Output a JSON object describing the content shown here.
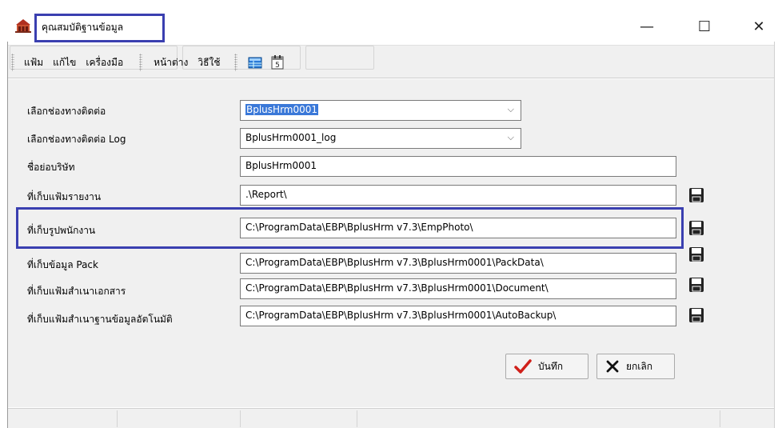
{
  "window": {
    "title": "คุณสมบัติฐานข้อมูล",
    "minimize": "—",
    "maximize": "☐",
    "close": "✕"
  },
  "menu": {
    "items": [
      "แฟ้ม",
      "แก้ไข",
      "เครื่องมือ"
    ],
    "items2": [
      "หน้าต่าง",
      "วิธีใช้"
    ]
  },
  "form": {
    "rows": [
      {
        "label": "เลือกช่องทางติดต่อ",
        "value": "BplusHrm0001",
        "type": "combo",
        "selected": true
      },
      {
        "label": "เลือกช่องทางติดต่อ Log",
        "value": "BplusHrm0001_log",
        "type": "combo"
      },
      {
        "label": "ชื่อย่อบริษัท",
        "value": "BplusHrm0001",
        "type": "text"
      },
      {
        "label": "ที่เก็บแฟ้มรายงาน",
        "value": ".\\Report\\",
        "type": "text",
        "save": true
      },
      {
        "label": "ที่เก็บรูปพนักงาน",
        "value": "C:\\ProgramData\\EBP\\BplusHrm v7.3\\EmpPhoto\\",
        "type": "text",
        "save": true
      },
      {
        "label": "ที่เก็บข้อมูล Pack",
        "value": "C:\\ProgramData\\EBP\\BplusHrm v7.3\\BplusHrm0001\\PackData\\",
        "type": "text",
        "save": true
      },
      {
        "label": "ที่เก็บแฟ้มสำเนาเอกสาร",
        "value": "C:\\ProgramData\\EBP\\BplusHrm v7.3\\BplusHrm0001\\Document\\",
        "type": "text",
        "save": true
      },
      {
        "label": "ที่เก็บแฟ้มสำเนาฐานข้อมูลอัตโนมัติ",
        "value": "C:\\ProgramData\\EBP\\BplusHrm v7.3\\BplusHrm0001\\AutoBackup\\",
        "type": "text",
        "save": true
      }
    ]
  },
  "buttons": {
    "save_label": "บันทึก",
    "cancel_label": "ยกเลิก"
  },
  "colors": {
    "highlight": "#3a3fb0",
    "selection": "#3a78d8"
  }
}
